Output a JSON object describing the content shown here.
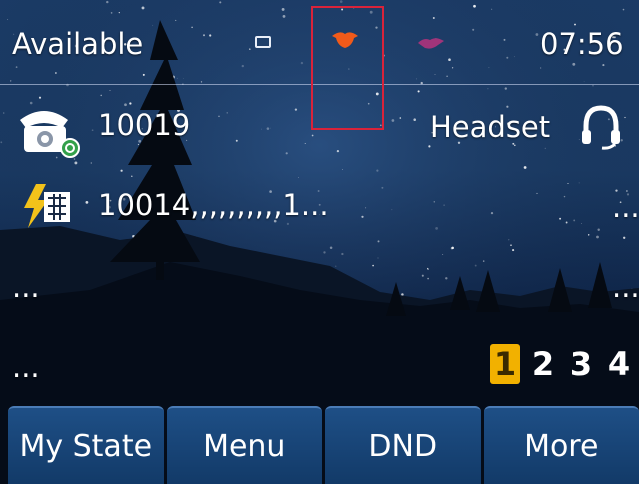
{
  "status_bar": {
    "presence": "Available",
    "time": "07:56",
    "icons": [
      "laptop-icon",
      "red-bird-icon",
      "purple-bird-icon"
    ]
  },
  "lines": [
    {
      "icon": "phone-registered-icon",
      "label": "10019"
    },
    {
      "icon": "blf-flash-icon",
      "label": "10014,,,,,,,,,,1..."
    }
  ],
  "headset": {
    "label": "Headset",
    "icon": "headset-icon"
  },
  "ellipses": {
    "right_line2": "...",
    "left_row3": "...",
    "right_row3": "...",
    "left_row4": "..."
  },
  "pages": [
    {
      "label": "1",
      "active": true
    },
    {
      "label": "2",
      "active": false
    },
    {
      "label": "3",
      "active": false
    },
    {
      "label": "4",
      "active": false
    }
  ],
  "softkeys": [
    "My State",
    "Menu",
    "DND",
    "More"
  ],
  "colors": {
    "accent_page": "#f2b100",
    "softkey": "#1b4a80",
    "highlight": "#d9233a"
  }
}
